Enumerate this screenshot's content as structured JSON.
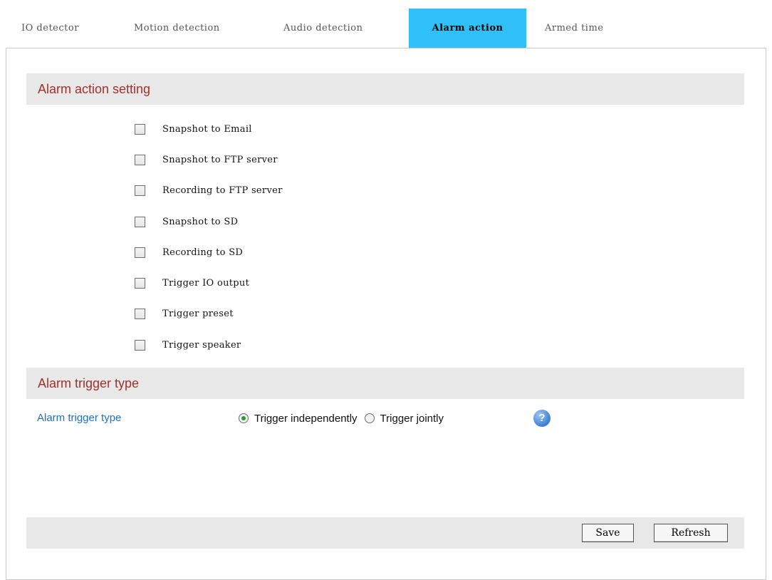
{
  "tabs": [
    {
      "label": "IO detector"
    },
    {
      "label": "Motion detection"
    },
    {
      "label": "Audio detection"
    },
    {
      "label": "Alarm action"
    },
    {
      "label": "Armed time"
    }
  ],
  "active_tab": "Alarm action",
  "action_section": {
    "title": "Alarm action setting",
    "options": [
      {
        "label": "Snapshot to Email",
        "checked": false
      },
      {
        "label": "Snapshot to FTP server",
        "checked": false
      },
      {
        "label": "Recording to FTP server",
        "checked": false
      },
      {
        "label": "Snapshot to SD",
        "checked": false
      },
      {
        "label": "Recording to SD",
        "checked": false
      },
      {
        "label": "Trigger IO output",
        "checked": false
      },
      {
        "label": "Trigger preset",
        "checked": false
      },
      {
        "label": "Trigger speaker",
        "checked": false
      }
    ]
  },
  "trigger_section": {
    "title": "Alarm trigger type",
    "field_label": "Alarm trigger type",
    "option_independent": "Trigger independently",
    "option_jointly": "Trigger jointly",
    "selected": "Trigger independently",
    "help_icon": "question-icon"
  },
  "footer": {
    "save_label": "Save",
    "refresh_label": "Refresh"
  },
  "colors": {
    "active_tab": "#2ec0f7",
    "section_title": "#a03030",
    "field_label": "#1f6fd0"
  }
}
